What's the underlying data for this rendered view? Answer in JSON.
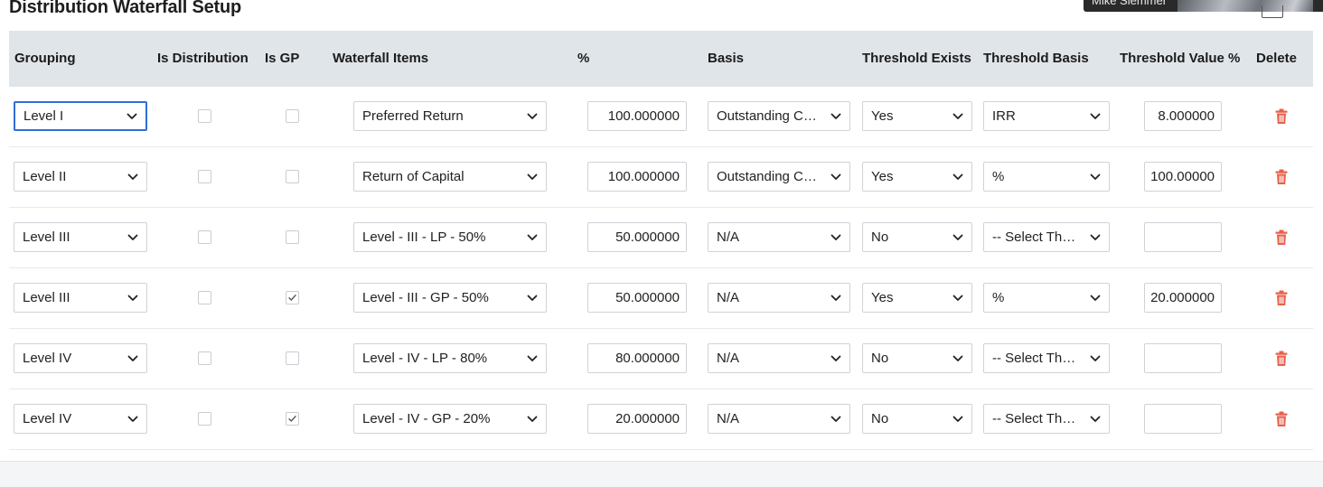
{
  "page": {
    "title": "Distribution Waterfall Setup",
    "video_user_name": "Mike Siemmer"
  },
  "columns": {
    "grouping": "Grouping",
    "is_distribution": "Is Distribution",
    "is_gp": "Is GP",
    "waterfall_items": "Waterfall Items",
    "percent": "%",
    "basis": "Basis",
    "threshold_exists": "Threshold Exists",
    "threshold_basis": "Threshold Basis",
    "threshold_value": "Threshold Value %",
    "delete": "Delete"
  },
  "rows": [
    {
      "grouping": "Level I",
      "is_distribution": false,
      "is_gp": false,
      "waterfall_item": "Preferred Return",
      "percent": "100.000000",
      "basis": "Outstanding C…",
      "threshold_exists": "Yes",
      "threshold_basis": "IRR",
      "threshold_value": "8.000000"
    },
    {
      "grouping": "Level II",
      "is_distribution": false,
      "is_gp": false,
      "waterfall_item": "Return of Capital",
      "percent": "100.000000",
      "basis": "Outstanding C…",
      "threshold_exists": "Yes",
      "threshold_basis": "%",
      "threshold_value": "100.00000"
    },
    {
      "grouping": "Level III",
      "is_distribution": false,
      "is_gp": false,
      "waterfall_item": "Level - III - LP - 50%",
      "percent": "50.000000",
      "basis": "N/A",
      "threshold_exists": "No",
      "threshold_basis": "-- Select Th…",
      "threshold_value": ""
    },
    {
      "grouping": "Level III",
      "is_distribution": false,
      "is_gp": true,
      "waterfall_item": "Level - III - GP - 50%",
      "percent": "50.000000",
      "basis": "N/A",
      "threshold_exists": "Yes",
      "threshold_basis": "%",
      "threshold_value": "20.000000"
    },
    {
      "grouping": "Level IV",
      "is_distribution": false,
      "is_gp": false,
      "waterfall_item": "Level - IV - LP - 80%",
      "percent": "80.000000",
      "basis": "N/A",
      "threshold_exists": "No",
      "threshold_basis": "-- Select Th…",
      "threshold_value": ""
    },
    {
      "grouping": "Level IV",
      "is_distribution": false,
      "is_gp": true,
      "waterfall_item": "Level - IV - GP - 20%",
      "percent": "20.000000",
      "basis": "N/A",
      "threshold_exists": "No",
      "threshold_basis": "-- Select Th…",
      "threshold_value": ""
    }
  ],
  "colors": {
    "header_bg": "#e0e5e9",
    "focus_border": "#2f6fd4",
    "delete_icon": "#e8604a"
  },
  "icons": {
    "delete": "trash-icon",
    "dropdown": "chevron-down-icon",
    "checked": "checkmark-icon"
  }
}
